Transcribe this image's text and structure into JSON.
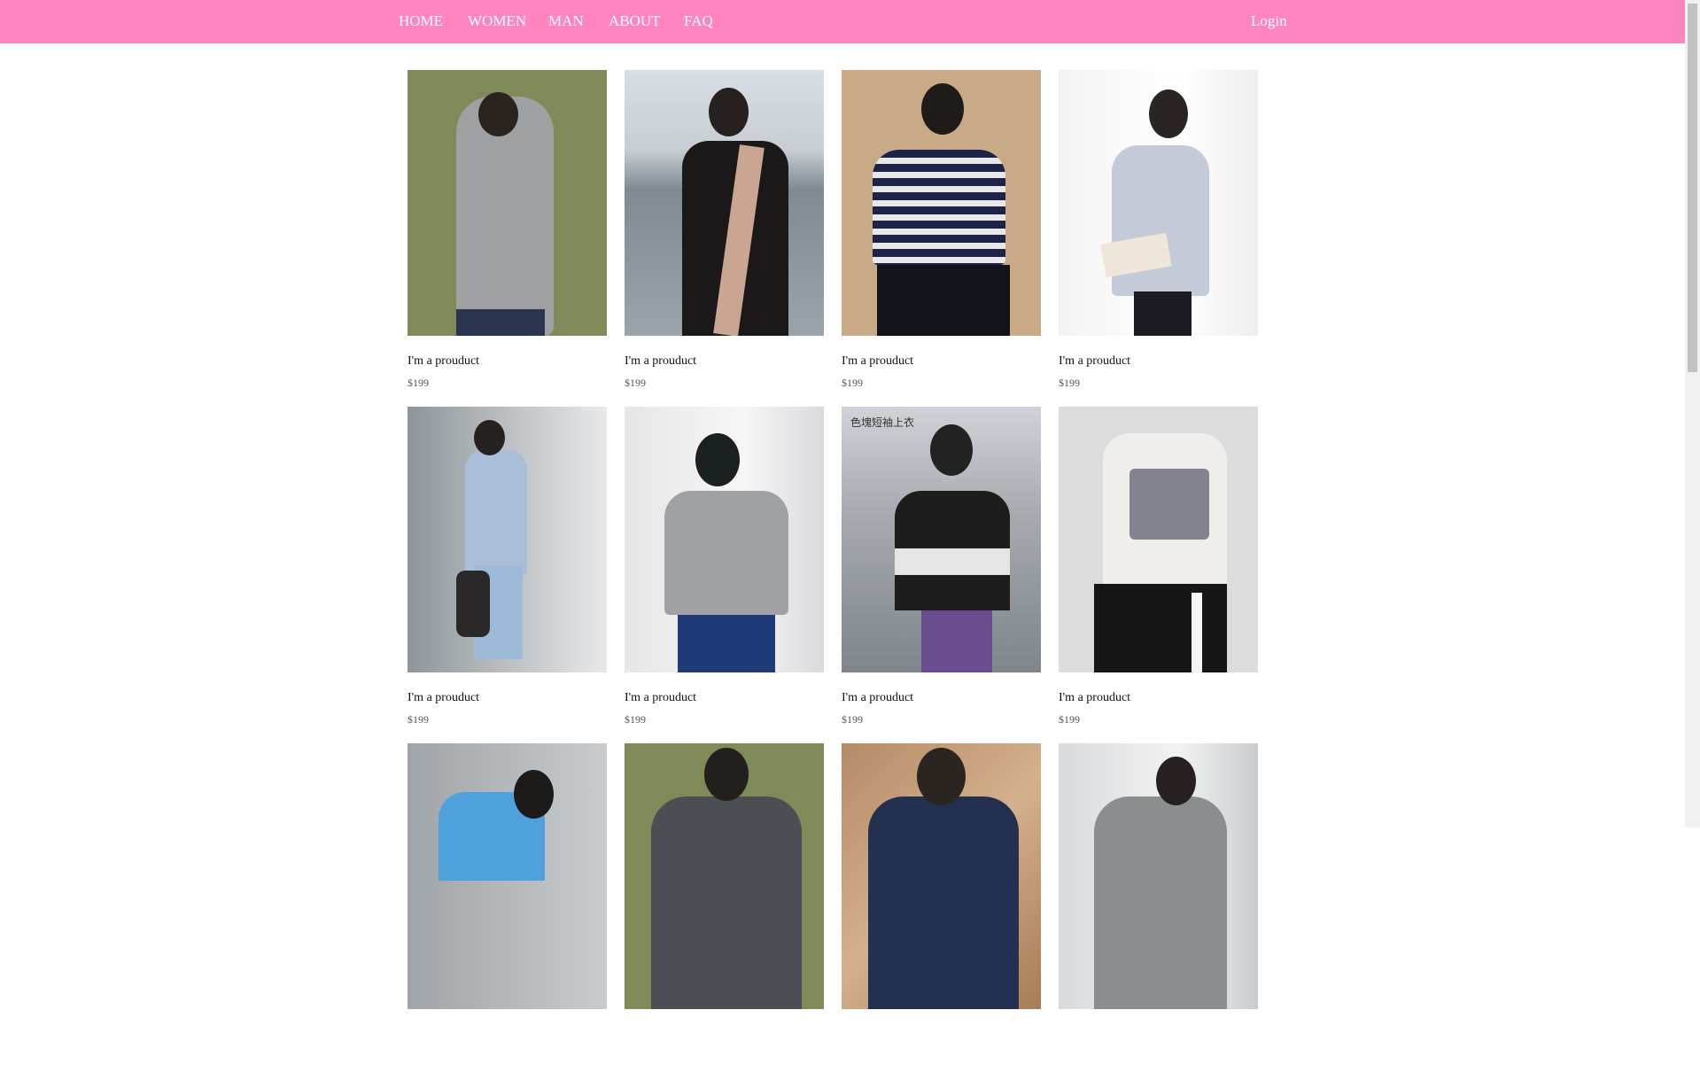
{
  "nav": {
    "home": "HOME",
    "women": "WOMEN",
    "man": "MAN",
    "about": "ABOUT",
    "faq": "FAQ",
    "login": "Login"
  },
  "colors": {
    "nav_background": "#ff85c0",
    "nav_text": "#ffffff"
  },
  "products": [
    {
      "name": "I'm a prouduct",
      "price": "$199",
      "photo_caption": ""
    },
    {
      "name": "I'm a prouduct",
      "price": "$199",
      "photo_caption": ""
    },
    {
      "name": "I'm a prouduct",
      "price": "$199",
      "photo_caption": ""
    },
    {
      "name": "I'm a prouduct",
      "price": "$199",
      "photo_caption": ""
    },
    {
      "name": "I'm a prouduct",
      "price": "$199",
      "photo_caption": ""
    },
    {
      "name": "I'm a prouduct",
      "price": "$199",
      "photo_caption": ""
    },
    {
      "name": "I'm a prouduct",
      "price": "$199",
      "photo_caption": "色塊短袖上衣"
    },
    {
      "name": "I'm a prouduct",
      "price": "$199",
      "photo_caption": ""
    },
    {
      "name": "",
      "price": "",
      "photo_caption": ""
    },
    {
      "name": "",
      "price": "",
      "photo_caption": ""
    },
    {
      "name": "",
      "price": "",
      "photo_caption": ""
    },
    {
      "name": "",
      "price": "",
      "photo_caption": ""
    }
  ]
}
